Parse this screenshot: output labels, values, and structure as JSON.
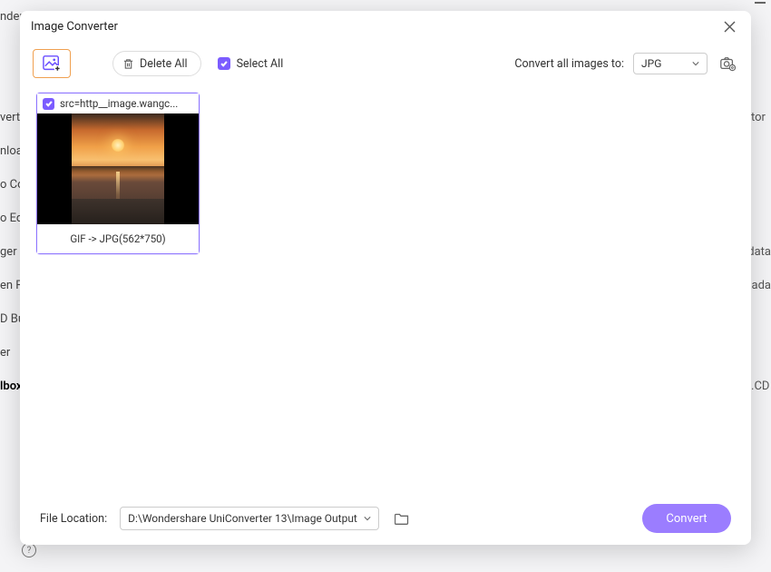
{
  "bg": {
    "left": [
      "nder",
      "",
      "",
      "verte",
      "nloa",
      "o Co",
      "o Ed",
      "ger",
      "en R",
      "D Bur",
      "er",
      "lbox"
    ],
    "right": [
      "",
      "",
      "",
      "tor",
      "",
      "",
      "",
      "data",
      "etada",
      "",
      "",
      "CD."
    ]
  },
  "header": {
    "title": "Image Converter"
  },
  "toolbar": {
    "delete_all": "Delete All",
    "select_all": "Select All",
    "convert_to_label": "Convert all images to:",
    "format_selected": "JPG"
  },
  "items": [
    {
      "checked": true,
      "name": "src=http__image.wangc...",
      "caption": "GIF -> JPG(562*750)"
    }
  ],
  "footer": {
    "label": "File Location:",
    "path": "D:\\Wondershare UniConverter 13\\Image Output",
    "convert": "Convert"
  }
}
